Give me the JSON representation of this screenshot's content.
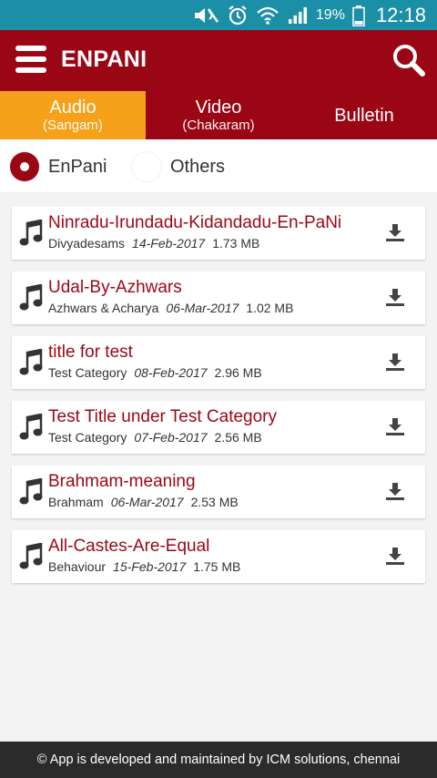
{
  "status_bar": {
    "icons": [
      "mute-icon",
      "alarm-icon",
      "wifi-icon",
      "signal-icon",
      "battery-icon"
    ],
    "battery": "19%",
    "time": "12:18"
  },
  "app_bar": {
    "title": "ENPANI",
    "menu_icon": "menu-icon",
    "search_icon": "search-icon"
  },
  "tabs": [
    {
      "label": "Audio",
      "sub": "(Sangam)",
      "active": true
    },
    {
      "label": "Video",
      "sub": "(Chakaram)",
      "active": false
    },
    {
      "label": "Bulletin",
      "sub": "",
      "active": false
    }
  ],
  "filters": [
    {
      "label": "EnPani",
      "checked": true
    },
    {
      "label": "Others",
      "checked": false
    }
  ],
  "items": [
    {
      "title": "Ninradu-Irundadu-Kidandadu-En-PaNi",
      "category": "Divyadesams",
      "date": "14-Feb-2017",
      "size": "1.73 MB"
    },
    {
      "title": "Udal-By-Azhwars",
      "category": "Azhwars & Acharya",
      "date": "06-Mar-2017",
      "size": "1.02 MB"
    },
    {
      "title": "title for test",
      "category": "Test Category",
      "date": "08-Feb-2017",
      "size": "2.96 MB"
    },
    {
      "title": "Test Title under Test Category",
      "category": "Test Category",
      "date": "07-Feb-2017",
      "size": "2.56 MB"
    },
    {
      "title": "Brahmam-meaning",
      "category": "Brahmam",
      "date": "06-Mar-2017",
      "size": "2.53 MB"
    },
    {
      "title": "All-Castes-Are-Equal",
      "category": "Behaviour",
      "date": "15-Feb-2017",
      "size": "1.75 MB"
    }
  ],
  "footer": {
    "text": "© App is developed and maintained by ICM solutions, chennai"
  },
  "colors": {
    "status_bar": "#1a8fa6",
    "brand": "#9b0614",
    "tab_active": "#f6a11a",
    "footer": "#2b2b2b"
  }
}
